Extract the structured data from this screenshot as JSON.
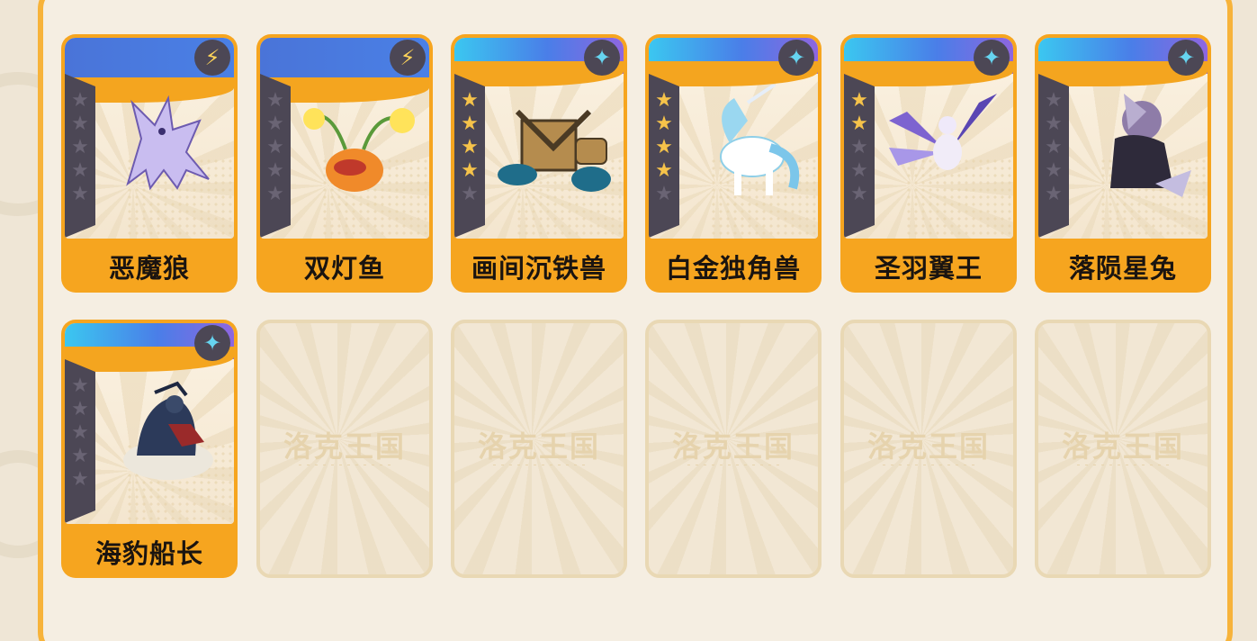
{
  "palette": {
    "frame_orange": "#f7b33a",
    "card_orange": "#f6a51f",
    "star_gold": "#f6c34a",
    "star_panel": "#4c4755",
    "background": "#efe6d6"
  },
  "top_tabs": [
    {},
    {},
    {},
    {}
  ],
  "collection": {
    "cards": [
      {
        "name": "恶魔狼",
        "stars_filled": 0,
        "stars_total": 5,
        "badge_icon": "lightning-star-icon",
        "band": "blue"
      },
      {
        "name": "双灯鱼",
        "stars_filled": 0,
        "stars_total": 5,
        "badge_icon": "lightning-star-icon",
        "band": "blue"
      },
      {
        "name": "画间沉铁兽",
        "stars_filled": 4,
        "stars_total": 5,
        "badge_icon": "rainbow-star-icon",
        "band": "rainbow"
      },
      {
        "name": "白金独角兽",
        "stars_filled": 4,
        "stars_total": 5,
        "badge_icon": "rainbow-star-icon",
        "band": "rainbow"
      },
      {
        "name": "圣羽翼王",
        "stars_filled": 2,
        "stars_total": 5,
        "badge_icon": "rainbow-star-icon",
        "band": "rainbow"
      },
      {
        "name": "落陨星兔",
        "stars_filled": 0,
        "stars_total": 5,
        "badge_icon": "rainbow-star-icon",
        "band": "rainbow"
      },
      {
        "name": "海豹船长",
        "stars_filled": 0,
        "stars_total": 5,
        "badge_icon": "rainbow-star-icon",
        "band": "rainbow"
      }
    ],
    "empty_slots": [
      {
        "watermark": "洛克王国"
      },
      {
        "watermark": "洛克王国"
      },
      {
        "watermark": "洛克王国"
      },
      {
        "watermark": "洛克王国"
      },
      {
        "watermark": "洛克王国"
      }
    ]
  }
}
